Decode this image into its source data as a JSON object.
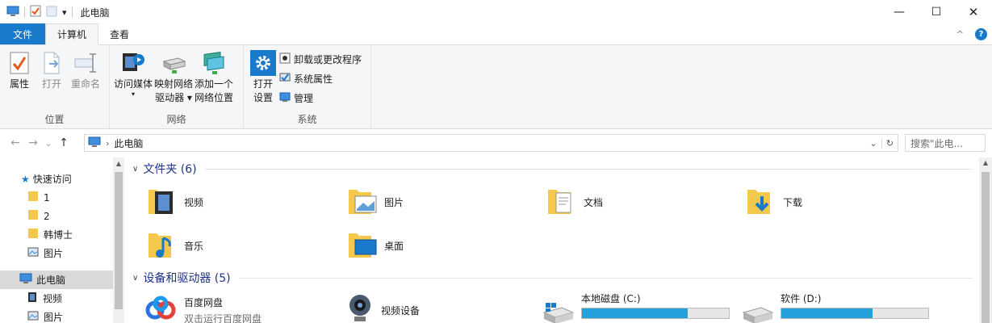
{
  "window": {
    "title": "此电脑",
    "qat_dropdown": "▾",
    "minimize": "—",
    "maximize": "☐",
    "close": "✕"
  },
  "ribbon_tabs": {
    "file": "文件",
    "computer": "计算机",
    "view": "查看",
    "collapse": "^",
    "help": "?"
  },
  "ribbon": {
    "location": {
      "label": "位置",
      "properties": "属性",
      "open": "打开",
      "rename": "重命名"
    },
    "network": {
      "label": "网络",
      "access_media": "访问媒体",
      "access_media_arrow": "▾",
      "map_drive_line1": "映射网络",
      "map_drive_line2": "驱动器 ▾",
      "add_location_line1": "添加一个",
      "add_location_line2": "网络位置"
    },
    "system": {
      "label": "系统",
      "open_settings_line1": "打开",
      "open_settings_line2": "设置",
      "uninstall": "卸载或更改程序",
      "system_properties": "系统属性",
      "manage": "管理"
    }
  },
  "navigation": {
    "back": "←",
    "forward": "→",
    "recent": "⌄",
    "up": "↑",
    "breadcrumb_arrow": "›",
    "location": "此电脑",
    "dropdown": "⌄",
    "refresh": "↻",
    "search_placeholder": "搜索\"此电..."
  },
  "sidebar": {
    "items": [
      {
        "label": "快速访问"
      },
      {
        "label": "1"
      },
      {
        "label": "2"
      },
      {
        "label": "韩博士"
      },
      {
        "label": "图片"
      },
      {
        "label": "此电脑"
      },
      {
        "label": "视频"
      },
      {
        "label": "图片"
      }
    ]
  },
  "content": {
    "folders_header": "文件夹 (6)",
    "folders": [
      {
        "label": "视频"
      },
      {
        "label": "图片"
      },
      {
        "label": "文档"
      },
      {
        "label": "下载"
      },
      {
        "label": "音乐"
      },
      {
        "label": "桌面"
      }
    ],
    "devices_header": "设备和驱动器 (5)",
    "devices": [
      {
        "label": "百度网盘",
        "sub": "双击运行百度网盘"
      },
      {
        "label": "视频设备"
      },
      {
        "label": "本地磁盘 (C:)",
        "fill": 0.72
      },
      {
        "label": "软件 (D:)",
        "fill": 0.62
      }
    ]
  },
  "colors": {
    "accent": "#1979ca",
    "header_text": "#1e3287",
    "drive_fill": "#26a0da",
    "folder": "#f3c84b"
  }
}
